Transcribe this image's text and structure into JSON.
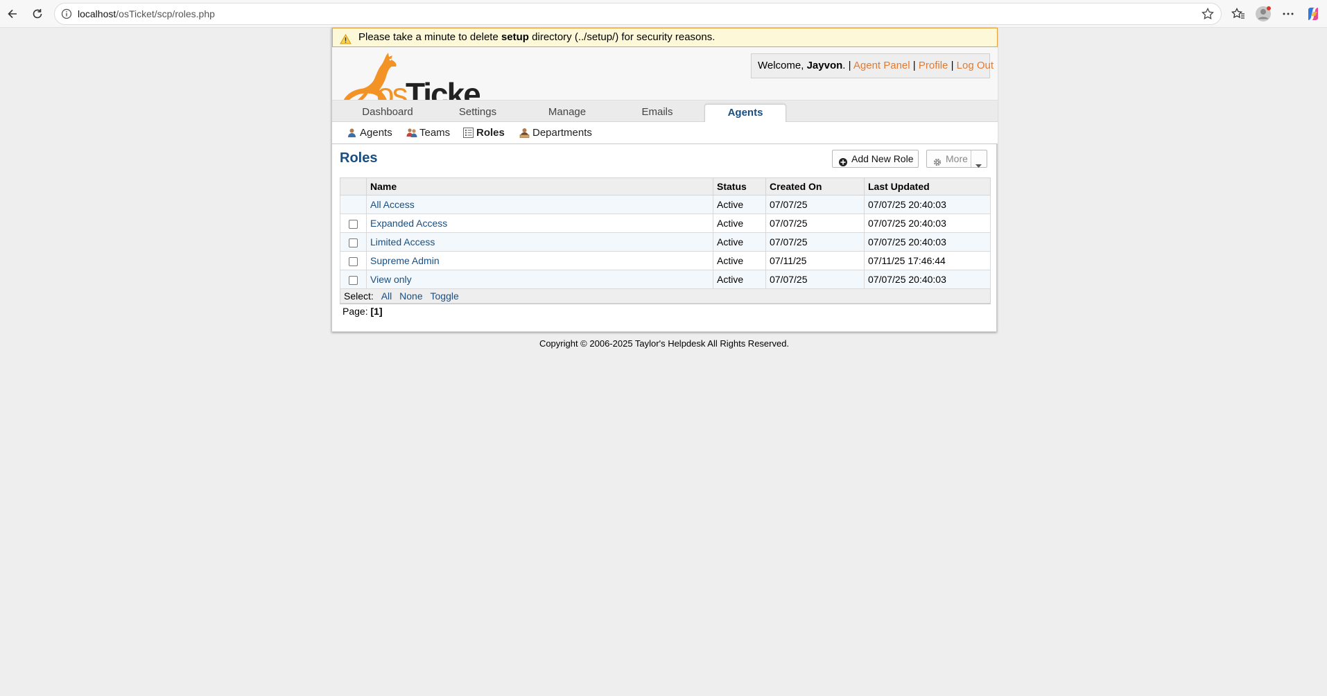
{
  "browser": {
    "url_host": "localhost",
    "url_path": "/osTicket/scp/roles.php"
  },
  "notice": {
    "prefix": "Please take a minute to delete",
    "bold": "setup",
    "suffix": "directory (../setup/) for security reasons."
  },
  "header": {
    "logo_text": "osTicket",
    "welcome_prefix": "Welcome,",
    "user_name": "Jayvon",
    "welcome_sep": ". |",
    "agent_panel": "Agent Panel",
    "pipe": "|",
    "profile": "Profile",
    "logout": "Log Out"
  },
  "nav": {
    "tabs": [
      {
        "label": "Dashboard"
      },
      {
        "label": "Settings"
      },
      {
        "label": "Manage"
      },
      {
        "label": "Emails"
      },
      {
        "label": "Agents"
      }
    ]
  },
  "subnav": {
    "items": [
      {
        "label": "Agents"
      },
      {
        "label": "Teams"
      },
      {
        "label": "Roles"
      },
      {
        "label": "Departments"
      }
    ]
  },
  "main": {
    "title": "Roles",
    "add_button": "Add New Role",
    "more_button": "More"
  },
  "table": {
    "columns": [
      "Name",
      "Status",
      "Created On",
      "Last Updated"
    ],
    "rows": [
      {
        "name": "All Access",
        "status": "Active",
        "created": "07/07/25",
        "updated": "07/07/25 20:40:03"
      },
      {
        "name": "Expanded Access",
        "status": "Active",
        "created": "07/07/25",
        "updated": "07/07/25 20:40:03"
      },
      {
        "name": "Limited Access",
        "status": "Active",
        "created": "07/07/25",
        "updated": "07/07/25 20:40:03"
      },
      {
        "name": "Supreme Admin",
        "status": "Active",
        "created": "07/11/25",
        "updated": "07/11/25 17:46:44"
      },
      {
        "name": "View only",
        "status": "Active",
        "created": "07/07/25",
        "updated": "07/07/25 20:40:03"
      }
    ],
    "select_label": "Select:",
    "select_all": "All",
    "select_none": "None",
    "select_toggle": "Toggle"
  },
  "pager": {
    "label": "Page:",
    "current": "[1]"
  },
  "footer": {
    "text": "Copyright © 2006-2025 Taylor's Helpdesk All Rights Reserved."
  },
  "colors": {
    "accent_blue": "#184e81",
    "brand_orange": "#e07b33",
    "notice_bg": "#fdf8d7"
  }
}
